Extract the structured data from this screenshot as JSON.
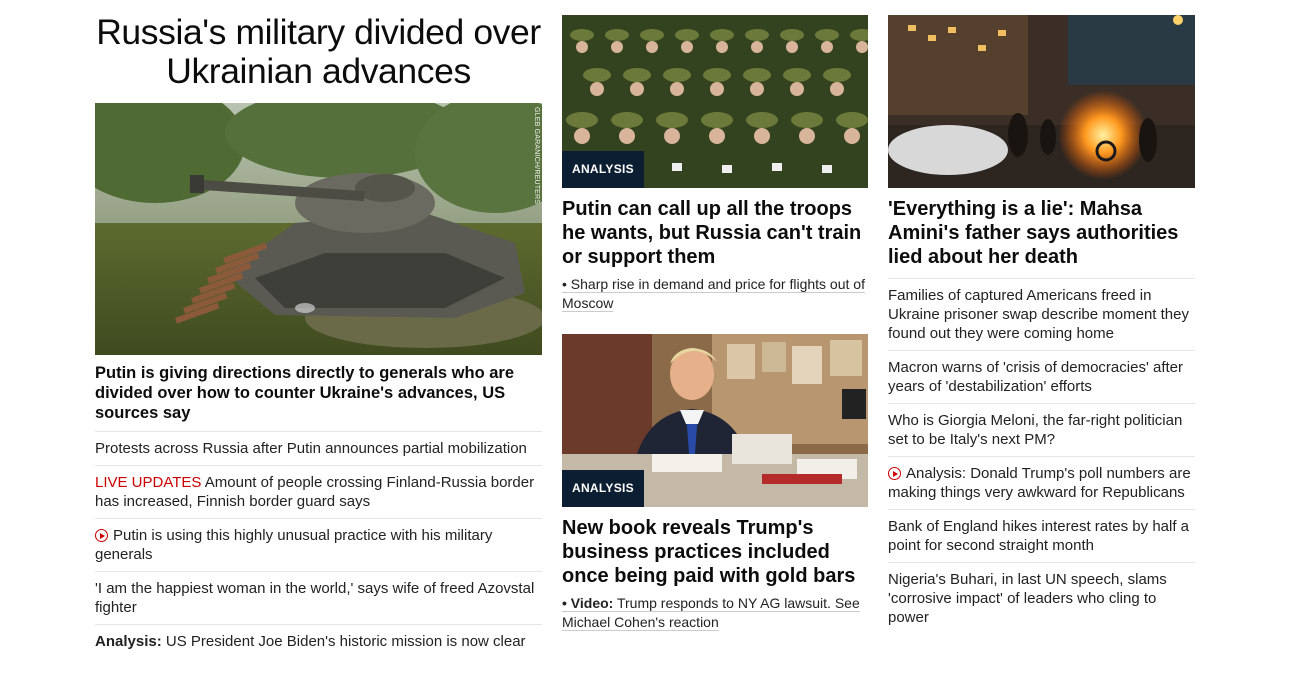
{
  "col1": {
    "headline": "Russia's military divided over Ukrainian advances",
    "image": {
      "alt": "destroyed tank",
      "credit": "GLEB GARANICH/REUTERS"
    },
    "lead": "Putin is giving directions directly to generals who are divided over how to counter Ukraine's advances, US sources say",
    "stories": [
      {
        "text": "Protests across Russia after Putin announces partial mobilization"
      },
      {
        "prefix": "LIVE UPDATES",
        "text": " Amount of people crossing Finland-Russia border has increased, Finnish border guard says"
      },
      {
        "icon": "play-icon",
        "text": "Putin is using this highly unusual practice with his military generals"
      },
      {
        "text": "'I am the happiest woman in the world,' says wife of freed Azovstal fighter"
      },
      {
        "prefix": "Analysis:",
        "text": " US President Joe Biden's historic mission is now clear"
      }
    ]
  },
  "col2": {
    "card1": {
      "badge": "ANALYSIS",
      "title": "Putin can call up all the troops he wants, but Russia can't train or support them",
      "sub": "• Sharp rise in demand and price for flights out of Moscow"
    },
    "card2": {
      "badge": "ANALYSIS",
      "title": "New book reveals Trump's business practices included once being paid with gold bars",
      "sub_prefix": "• Video:",
      "sub": " Trump responds to NY AG lawsuit. See Michael Cohen's reaction"
    }
  },
  "col3": {
    "title": "'Everything is a lie': Mahsa Amini's father says authorities lied about her death",
    "stories": [
      {
        "text": "Families of captured Americans freed in Ukraine prisoner swap describe moment they found out they were coming home"
      },
      {
        "text": "Macron warns of 'crisis of democracies' after years of 'destabilization' efforts"
      },
      {
        "text": "Who is Giorgia Meloni, the far-right politician set to be Italy's next PM?"
      },
      {
        "icon": "play-icon",
        "text": "Analysis: Donald Trump's poll numbers are making things very awkward for Republicans"
      },
      {
        "text": "Bank of England hikes interest rates by half a point for second straight month"
      },
      {
        "text": "Nigeria's Buhari, in last UN speech, slams 'corrosive impact' of leaders who cling to power"
      }
    ]
  },
  "colors": {
    "live": "#cc0000",
    "badge_bg": "#0c1e32",
    "divider": "#e6e6e6"
  }
}
